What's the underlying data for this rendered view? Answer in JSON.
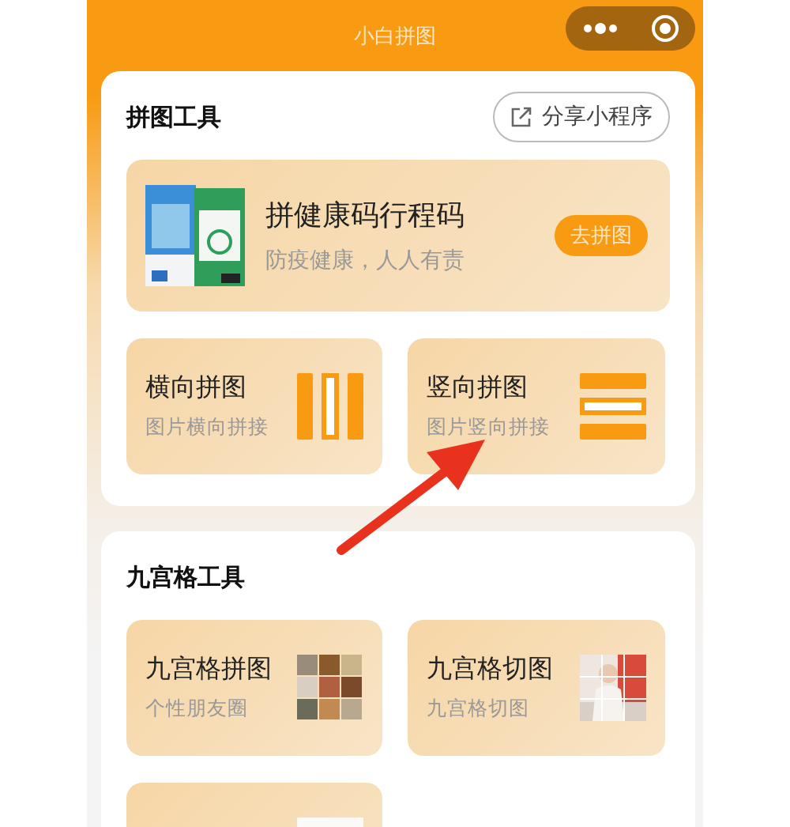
{
  "title": "小白拼图",
  "section_1": {
    "title": "拼图工具",
    "share_button": "分享小程序",
    "featured": {
      "title": "拼健康码行程码",
      "subtitle": "防疫健康，人人有责",
      "button": "去拼图"
    },
    "tiles": [
      {
        "kind": "columns",
        "title": "横向拼图",
        "subtitle": "图片横向拼接"
      },
      {
        "kind": "rows",
        "title": "竖向拼图",
        "subtitle": "图片竖向拼接"
      }
    ]
  },
  "section_2": {
    "title": "九宫格工具",
    "tiles": [
      {
        "kind": "grid",
        "title": "九宫格拼图",
        "subtitle": "个性朋友圈"
      },
      {
        "kind": "cut",
        "title": "九宫格切图",
        "subtitle": "九宫格切图"
      },
      {
        "kind": "partial"
      }
    ]
  }
}
